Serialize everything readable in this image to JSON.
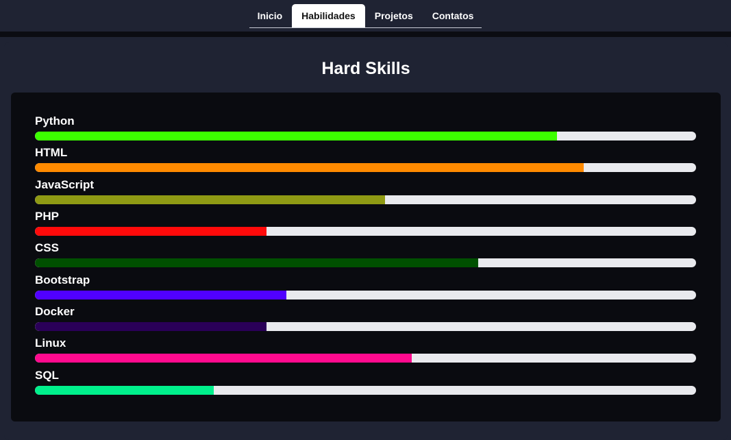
{
  "nav": {
    "tabs": [
      {
        "label": "Inicio",
        "active": false
      },
      {
        "label": "Habilidades",
        "active": true
      },
      {
        "label": "Projetos",
        "active": false
      },
      {
        "label": "Contatos",
        "active": false
      }
    ]
  },
  "section": {
    "title": "Hard Skills"
  },
  "skills": [
    {
      "name": "Python",
      "level": 0.79,
      "color": "#3cff00"
    },
    {
      "name": "HTML",
      "level": 0.83,
      "color": "#ff8a00"
    },
    {
      "name": "JavaScript",
      "level": 0.53,
      "color": "#8f9a14"
    },
    {
      "name": "PHP",
      "level": 0.35,
      "color": "#ff0a0a"
    },
    {
      "name": "CSS",
      "level": 0.67,
      "color": "#005000"
    },
    {
      "name": "Bootstrap",
      "level": 0.38,
      "color": "#5000ff"
    },
    {
      "name": "Docker",
      "level": 0.35,
      "color": "#2a0058"
    },
    {
      "name": "Linux",
      "level": 0.57,
      "color": "#ff0a8e"
    },
    {
      "name": "SQL",
      "level": 0.27,
      "color": "#00f08c"
    }
  ]
}
